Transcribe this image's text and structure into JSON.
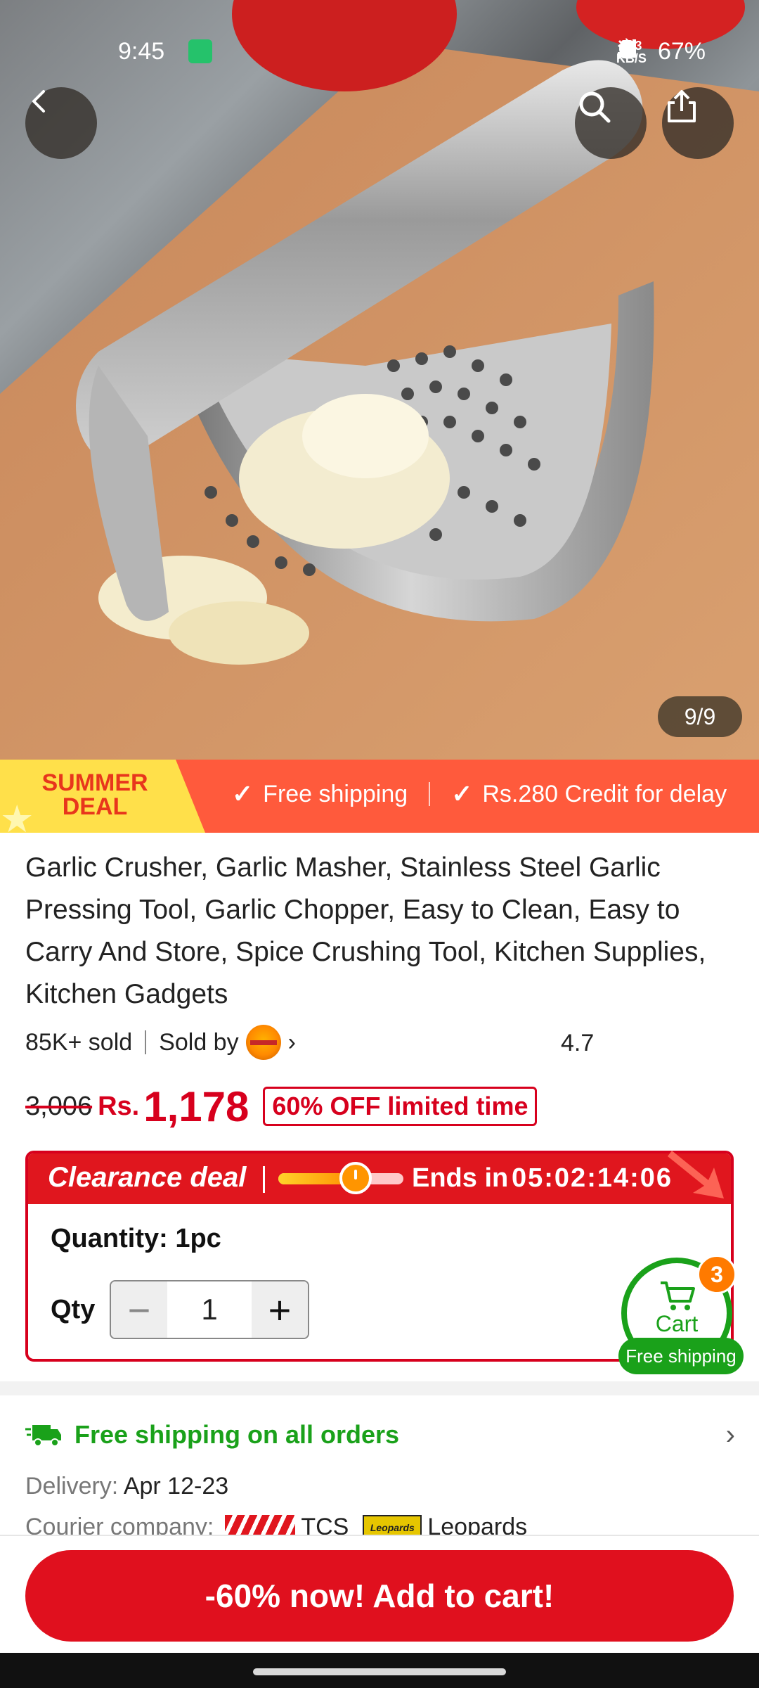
{
  "status_bar": {
    "time": "9:45",
    "net_speed": "233",
    "net_unit": "KB/S",
    "battery": "67%"
  },
  "hero": {
    "image_counter": "9/9",
    "icons": [
      "back-icon",
      "search-icon",
      "share-icon"
    ]
  },
  "promo": {
    "deal_label_line1": "SUMMER",
    "deal_label_line2": "DEAL",
    "item1": "Free shipping",
    "item2": "Rs.280 Credit for delay"
  },
  "product": {
    "title": "Garlic Crusher, Garlic Masher, Stainless Steel Garlic Pressing Tool, Garlic Chopper, Easy to Clean, Easy to Carry And Store, Spice Crushing Tool, Kitchen Supplies, Kitchen Gadgets",
    "sold": "85K+ sold",
    "sold_by": "Sold by",
    "rating": "4.7",
    "old_price": "3,006",
    "currency": "Rs.",
    "price": "1,178",
    "discount": "60% OFF limited time"
  },
  "clearance": {
    "title": "Clearance deal",
    "progress_fraction": 0.62,
    "ends_label": "Ends in",
    "timer": "05:02:14:06",
    "quantity_label": "Quantity: 1pc",
    "qty_label": "Qty",
    "qty_value": "1"
  },
  "cart": {
    "label": "Cart",
    "badge": "3",
    "pill": "Free shipping"
  },
  "shipping": {
    "headline": "Free shipping on all orders",
    "delivery_key": "Delivery:",
    "delivery_value": "Apr 12-23",
    "courier_key": "Courier company:",
    "courier1": "TCS",
    "courier2": "Leopards",
    "courier2_logo_text": "Leopards"
  },
  "cta": {
    "label": "-60% now! Add to cart!"
  },
  "colors": {
    "accent_red": "#e0101e",
    "promo_orange": "#ff5a3c",
    "deal_yellow": "#ffe04a",
    "green": "#1aa11a"
  }
}
